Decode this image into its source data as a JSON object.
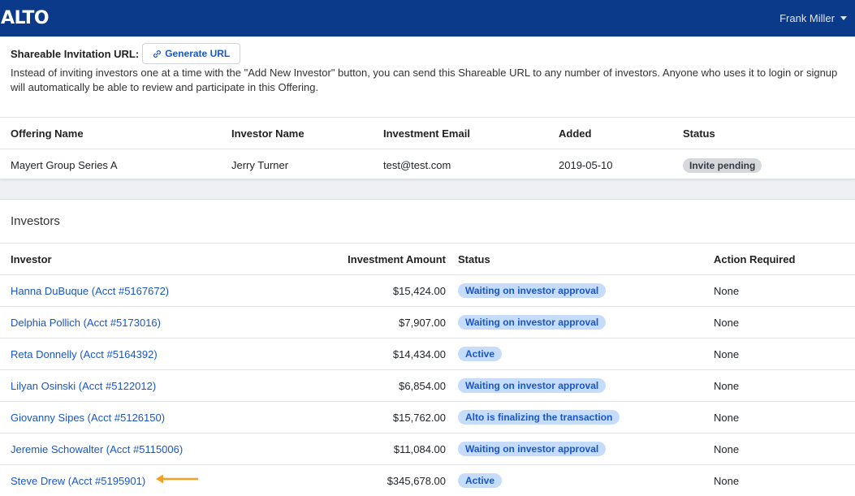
{
  "navbar": {
    "logo": "ALTO",
    "user_name": "Frank Miller"
  },
  "share": {
    "label": "Shareable Invitation URL:",
    "button_label": "Generate URL",
    "description": "Instead of inviting investors one at a time with the \"Add New Investor\" button, you can send this Shareable URL to any number of investors. Anyone who uses it to login or signup will automatically be able to review and participate in this Offering."
  },
  "invites": {
    "columns": [
      "Offering Name",
      "Investor Name",
      "Investment Email",
      "Added",
      "Status"
    ],
    "rows": [
      {
        "offering": "Mayert Group Series A",
        "investor": "Jerry Turner",
        "email": "test@test.com",
        "added": "2019-05-10",
        "status": "Invite pending"
      }
    ]
  },
  "investors": {
    "title": "Investors",
    "columns": [
      "Investor",
      "Investment Amount",
      "Status",
      "Action Required"
    ],
    "rows": [
      {
        "investor": "Hanna DuBuque (Acct #5167672)",
        "amount": "$15,424.00",
        "status": "Waiting on investor approval",
        "action": "None"
      },
      {
        "investor": "Delphia Pollich (Acct #5173016)",
        "amount": "$7,907.00",
        "status": "Waiting on investor approval",
        "action": "None"
      },
      {
        "investor": "Reta Donnelly (Acct #5164392)",
        "amount": "$14,434.00",
        "status": "Active",
        "action": "None"
      },
      {
        "investor": "Lilyan Osinski (Acct #5122012)",
        "amount": "$6,854.00",
        "status": "Waiting on investor approval",
        "action": "None"
      },
      {
        "investor": "Giovanny Sipes (Acct #5126150)",
        "amount": "$15,762.00",
        "status": "Alto is finalizing the transaction",
        "action": "None"
      },
      {
        "investor": "Jeremie Schowalter (Acct #5115006)",
        "amount": "$11,084.00",
        "status": "Waiting on investor approval",
        "action": "None"
      },
      {
        "investor": "Steve Drew (Acct #5195901)",
        "amount": "$345,678.00",
        "status": "Active",
        "action": "None"
      }
    ]
  },
  "colors": {
    "navbar": "#0b3a8a",
    "link": "#1a56c9",
    "badge_blue_bg": "#c6dcfb",
    "annotation_arrow": "#f5a020"
  },
  "icons": {
    "generate_button": "link-icon",
    "user_menu": "caret-down-icon",
    "annotation": "arrow-left-icon"
  }
}
